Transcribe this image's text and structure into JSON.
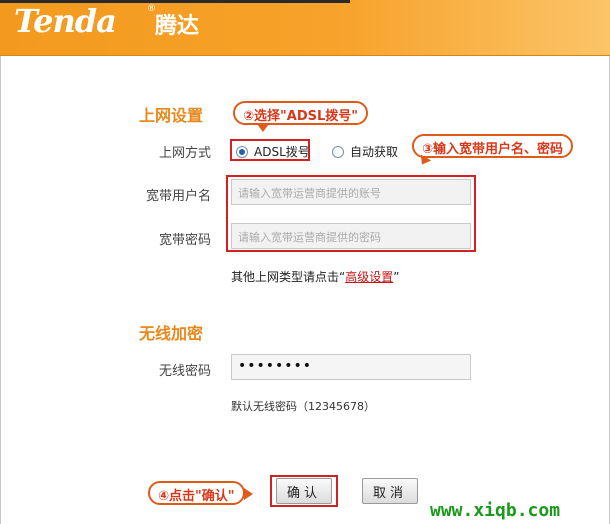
{
  "header": {
    "logo": "Tenda",
    "logo_cn": "腾达",
    "reg_mark": "®"
  },
  "internet": {
    "section_title": "上网设置",
    "connection_type_label": "上网方式",
    "options": [
      {
        "label": "ADSL拨号",
        "selected": true
      },
      {
        "label": "自动获取",
        "selected": false
      }
    ],
    "username_label": "宽带用户名",
    "username_placeholder": "请输入宽带运营商提供的账号",
    "password_label": "宽带密码",
    "password_placeholder": "请输入宽带运营商提供的密码",
    "advanced_prefix": "其他上网类型请点击“",
    "advanced_link": "高级设置",
    "advanced_suffix": "”"
  },
  "wireless": {
    "section_title": "无线加密",
    "password_label": "无线密码",
    "password_value": "••••••••",
    "default_note": "默认无线密码（12345678）"
  },
  "buttons": {
    "ok": "确认",
    "cancel": "取消"
  },
  "annotations": {
    "step2": "②选择\"ADSL拨号\"",
    "step3": "③输入宽带用户名、密码",
    "step4": "④点击\"确认\""
  },
  "watermark": "www.xiqb.com",
  "colors": {
    "header_orange": "#f39a1e",
    "section_title": "#e8891c",
    "annotation_red": "#d32020",
    "link_red": "#c81414"
  }
}
